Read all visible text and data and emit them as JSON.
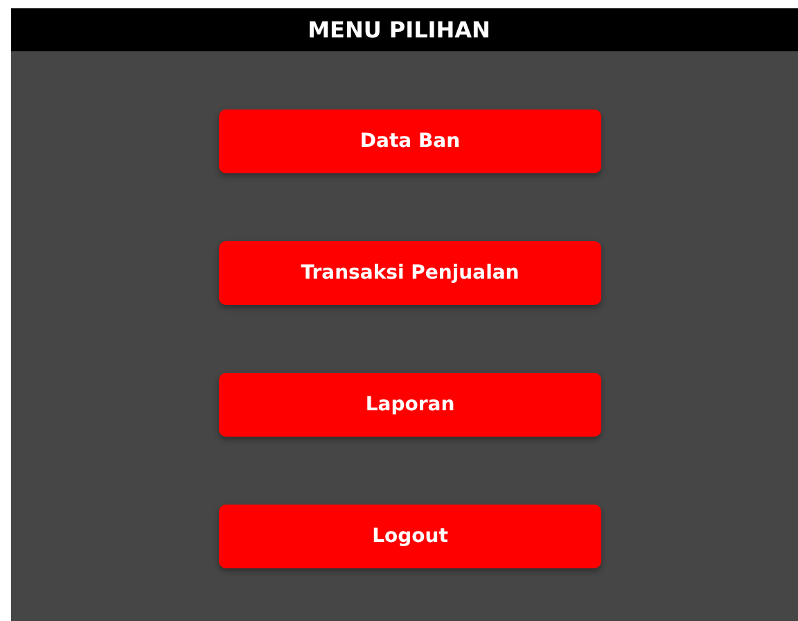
{
  "window": {
    "title": "MENU PILIHAN"
  },
  "buttons": [
    {
      "label": "Data Ban"
    },
    {
      "label": "Transaksi Penjualan"
    },
    {
      "label": "Laporan"
    },
    {
      "label": "Logout"
    }
  ]
}
